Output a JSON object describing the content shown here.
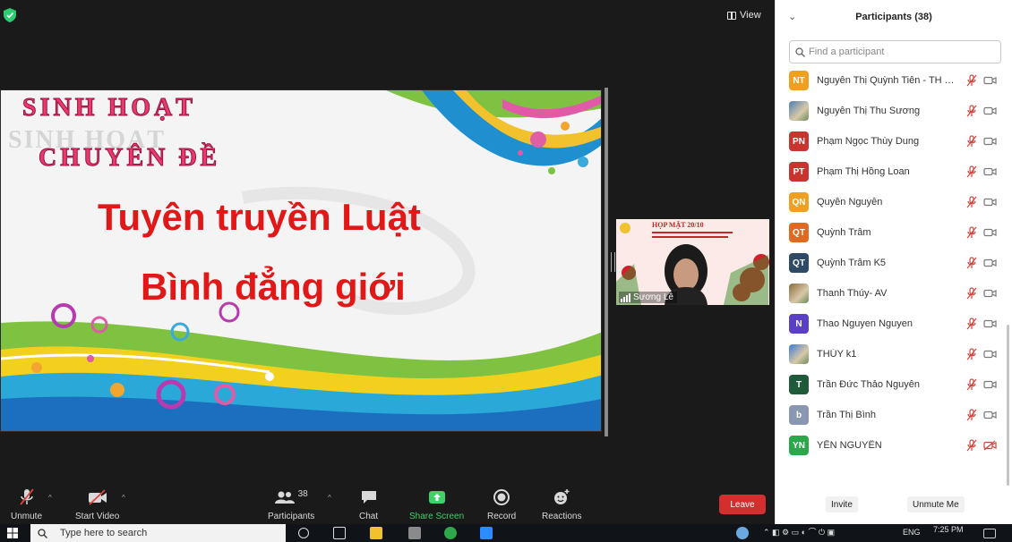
{
  "top": {
    "view_label": "View"
  },
  "slide": {
    "title_line1": "SINH HOẠT",
    "title_shadow": "SINH HOẠT",
    "title_line2": "CHUYÊN ĐỀ",
    "main_line1": "Tuyên truyền Luật",
    "main_line2": "Bình đẳng giới"
  },
  "video_tile": {
    "banner": "HỌP MẶT 20/10",
    "name": "Sương Lê"
  },
  "toolbar": {
    "unmute": "Unmute",
    "start_video": "Start Video",
    "participants": "Participants",
    "participants_count": "38",
    "chat": "Chat",
    "share_screen": "Share Screen",
    "record": "Record",
    "reactions": "Reactions",
    "leave": "Leave"
  },
  "panel": {
    "title": "Participants (38)",
    "search_placeholder": "Find a participant",
    "invite": "Invite",
    "unmute_me": "Unmute Me",
    "participants": [
      {
        "initials": "NT",
        "name": "Nguyễn Thị Quỳnh Tiên - TH Th...",
        "color": "#f0a020"
      },
      {
        "initials": "",
        "name": "Nguyễn Thị Thu Sương",
        "color": "#4a7fb5"
      },
      {
        "initials": "PN",
        "name": "Phạm Ngọc Thùy Dung",
        "color": "#c9342f"
      },
      {
        "initials": "PT",
        "name": "Phạm Thị Hồng Loan",
        "color": "#c9342f"
      },
      {
        "initials": "QN",
        "name": "Quyên Nguyễn",
        "color": "#f0a020"
      },
      {
        "initials": "QT",
        "name": "Quỳnh Trâm",
        "color": "#e06a1f"
      },
      {
        "initials": "QT",
        "name": "Quỳnh Trâm K5",
        "color": "#2e4a66"
      },
      {
        "initials": "",
        "name": "Thanh Thúy- AV",
        "color": "#8a6a3a"
      },
      {
        "initials": "N",
        "name": "Thao Nguyen Nguyen",
        "color": "#5b3fc4"
      },
      {
        "initials": "",
        "name": "THỦY k1",
        "color": "#3a7bd5"
      },
      {
        "initials": "T",
        "name": "Trần Đức Thảo Nguyên",
        "color": "#1f5a3a"
      },
      {
        "initials": "b",
        "name": "Trần Thị Bình",
        "color": "#8a97b0"
      },
      {
        "initials": "YN",
        "name": "YẾN NGUYÊN",
        "color": "#2aa84a"
      }
    ]
  },
  "taskbar": {
    "search_placeholder": "Type here to search",
    "lang": "ENG",
    "time": "7:25 PM"
  }
}
